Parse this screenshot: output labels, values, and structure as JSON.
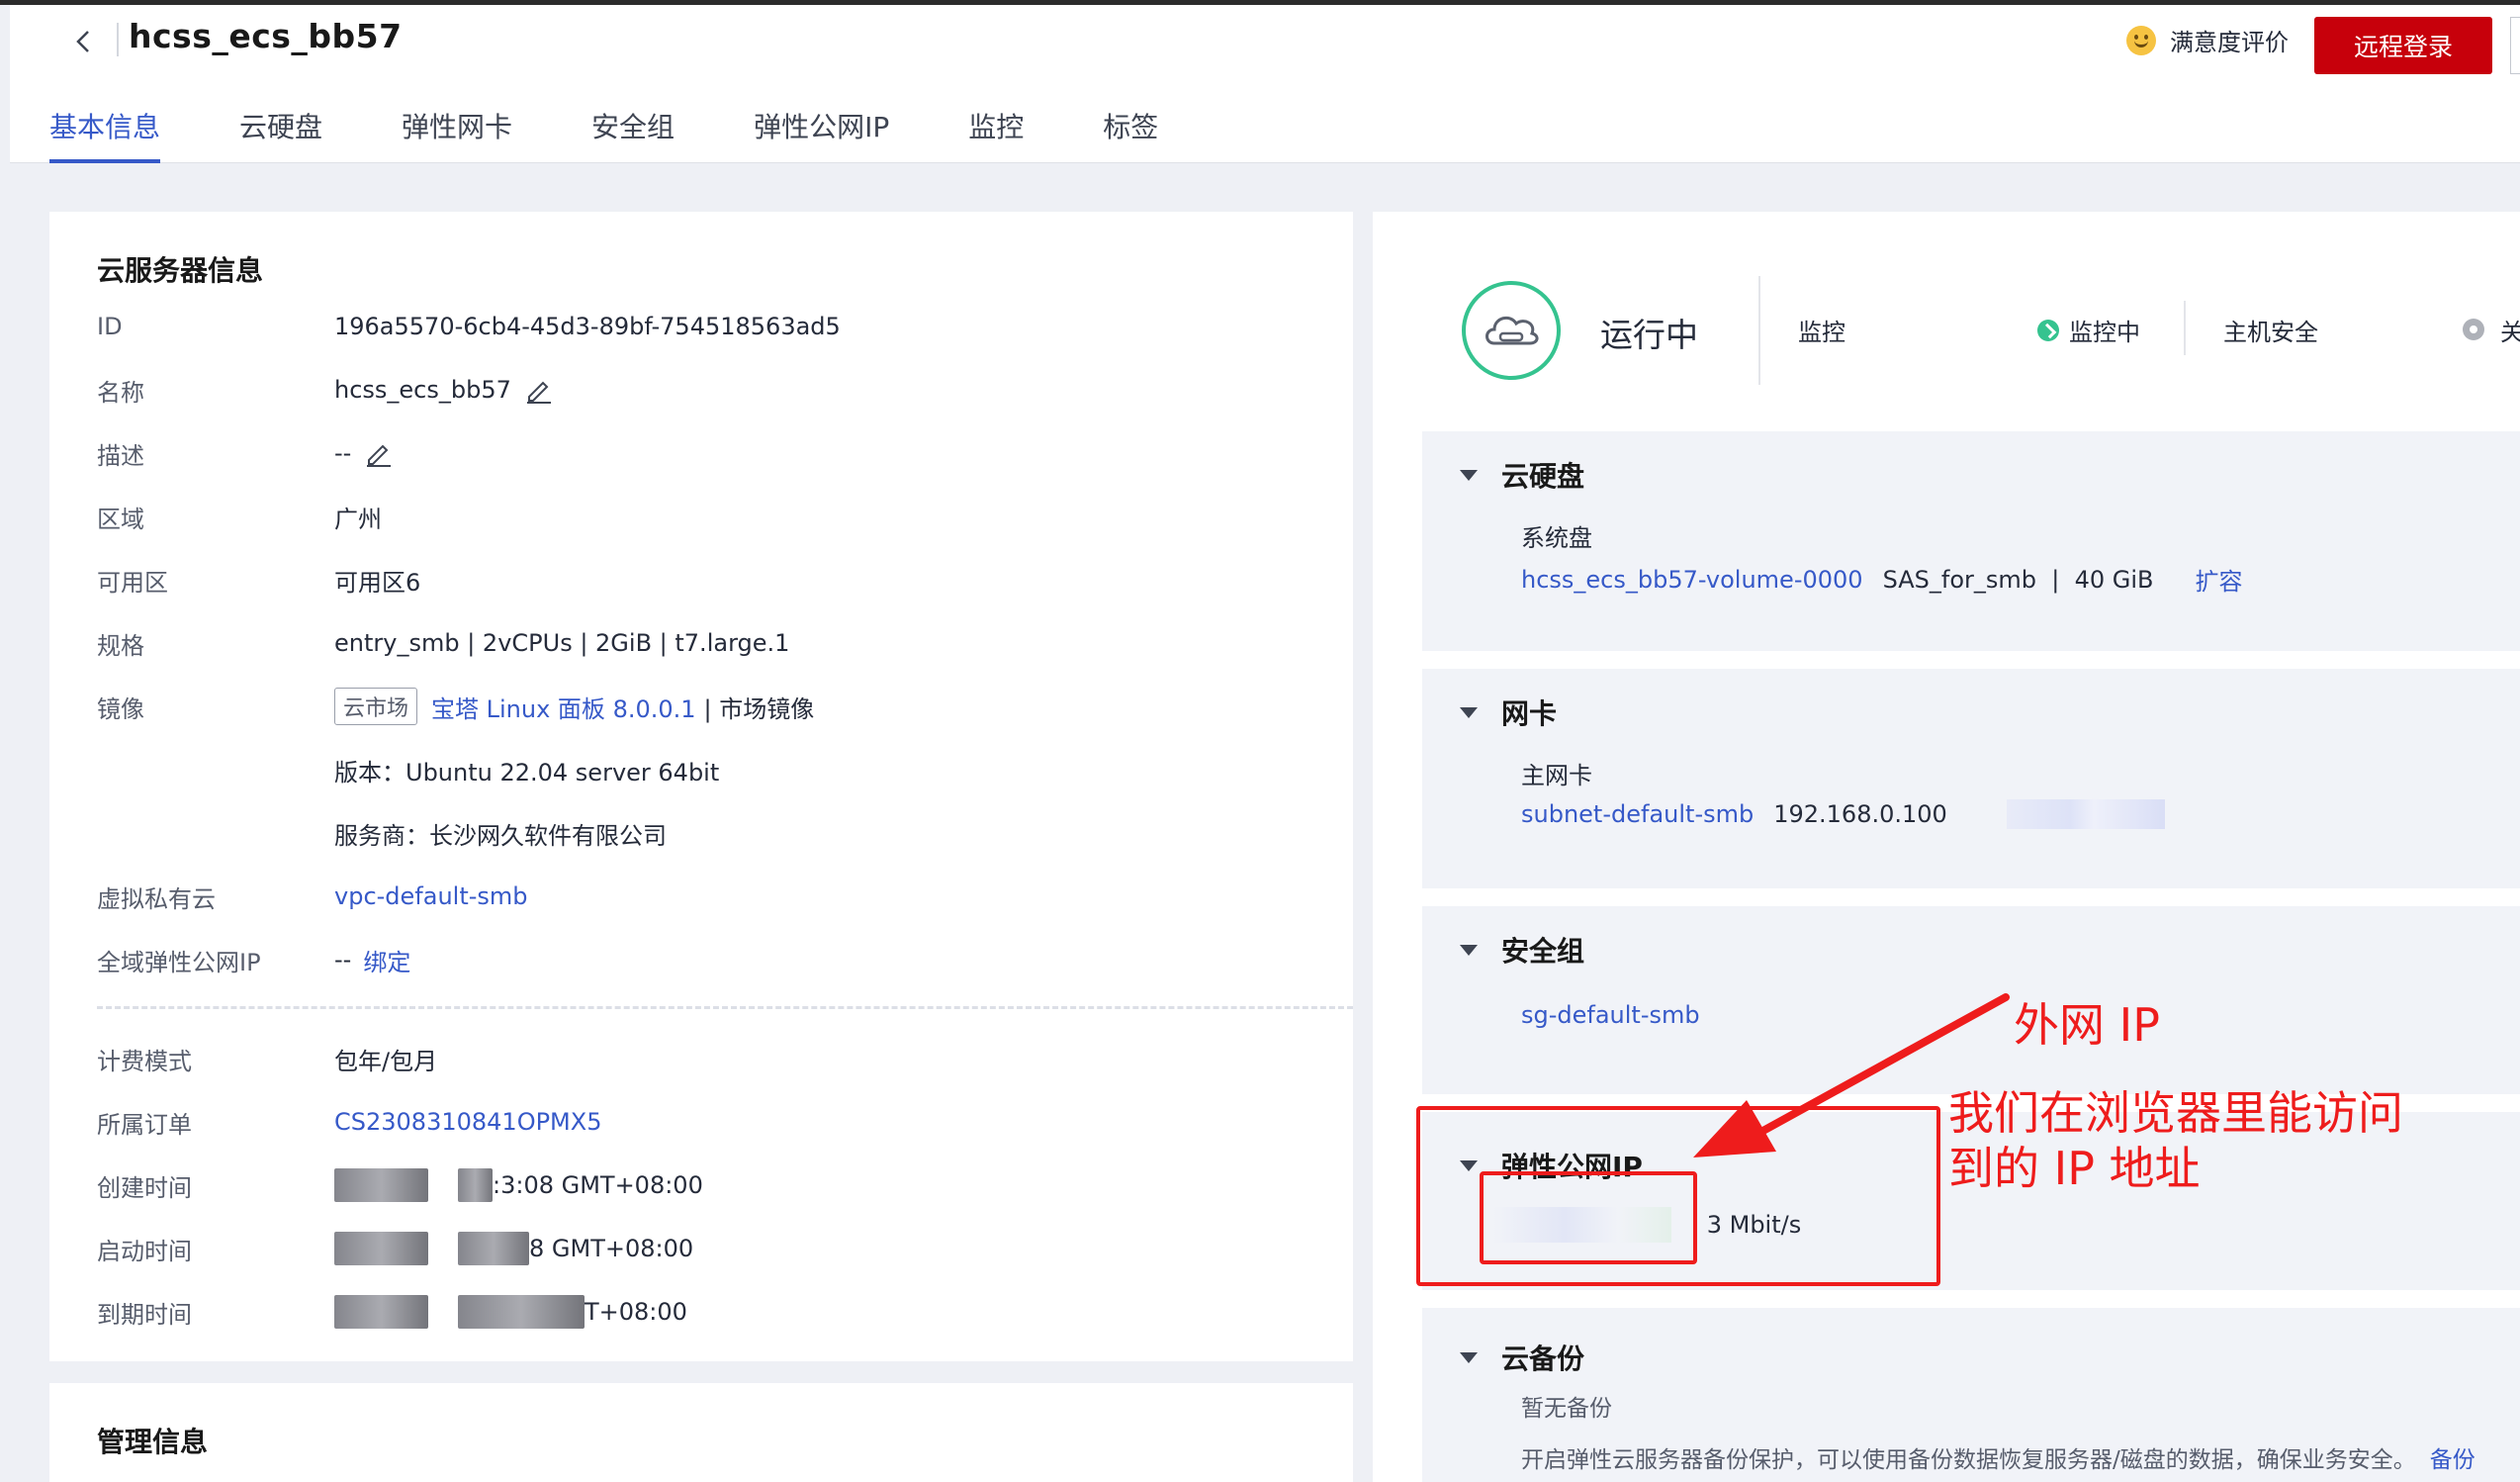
{
  "header": {
    "title": "hcss_ecs_bb57",
    "satisfaction_label": "满意度评价",
    "remote_login_label": "远程登录"
  },
  "tabs": [
    {
      "label": "基本信息",
      "active": true
    },
    {
      "label": "云硬盘"
    },
    {
      "label": "弹性网卡"
    },
    {
      "label": "安全组"
    },
    {
      "label": "弹性公网IP"
    },
    {
      "label": "监控"
    },
    {
      "label": "标签"
    }
  ],
  "server_info": {
    "section_title": "云服务器信息",
    "id_label": "ID",
    "id_value": "196a5570-6cb4-45d3-89bf-754518563ad5",
    "name_label": "名称",
    "name_value": "hcss_ecs_bb57",
    "desc_label": "描述",
    "desc_value": "--",
    "region_label": "区域",
    "region_value": "广州",
    "az_label": "可用区",
    "az_value": "可用区6",
    "spec_label": "规格",
    "spec_value": "entry_smb | 2vCPUs | 2GiB | t7.large.1",
    "image_label": "镜像",
    "image_tag": "云市场",
    "image_link": "宝塔 Linux 面板 8.0.0.1",
    "image_suffix": "| 市场镜像",
    "image_version": "版本：Ubuntu 22.04 server 64bit",
    "image_vendor": "服务商：长沙网久软件有限公司",
    "vpc_label": "虚拟私有云",
    "vpc_value": "vpc-default-smb",
    "global_eip_label": "全域弹性公网IP",
    "global_eip_value": "--",
    "global_eip_bind": "绑定",
    "billing_label": "计费模式",
    "billing_value": "包年/包月",
    "order_label": "所属订单",
    "order_value": "CS2308310841OPMX5",
    "created_label": "创建时间",
    "created_suffix": ":3:08 GMT+08:00",
    "started_label": "启动时间",
    "started_suffix": "8 GMT+08:00",
    "expire_label": "到期时间",
    "expire_suffix": "T+08:00"
  },
  "management": {
    "section_title": "管理信息"
  },
  "status": {
    "state": "运行中",
    "monitor_label": "监控",
    "monitor_state": "监控中",
    "host_security_label": "主机安全",
    "host_security_state": "关"
  },
  "panels": {
    "disk": {
      "title": "云硬盘",
      "sub": "系统盘",
      "volume_link": "hcss_ecs_bb57-volume-0000",
      "volume_spec": "SAS_for_smb  |  40 GiB",
      "expand": "扩容"
    },
    "nic": {
      "title": "网卡",
      "sub": "主网卡",
      "subnet_link": "subnet-default-smb",
      "ip": "192.168.0.100"
    },
    "secgroup": {
      "title": "安全组",
      "link": "sg-default-smb"
    },
    "eip": {
      "title": "弹性公网IP",
      "bandwidth": "| 3 Mbit/s"
    },
    "backup": {
      "title": "云备份",
      "sub": "暂无备份",
      "desc": "开启弹性云服务器备份保护，可以使用备份数据恢复服务器/磁盘的数据，确保业务安全。",
      "link": "备份"
    }
  },
  "annotations": {
    "external_ip": "外网 IP",
    "browser_note_line1": "我们在浏览器里能访问",
    "browser_note_line2": "到的 IP 地址"
  },
  "colors": {
    "accent": "#3659c8",
    "brand_red": "#c7000b",
    "status_green": "#35c38f",
    "annotation_red": "#ee1c1c"
  }
}
